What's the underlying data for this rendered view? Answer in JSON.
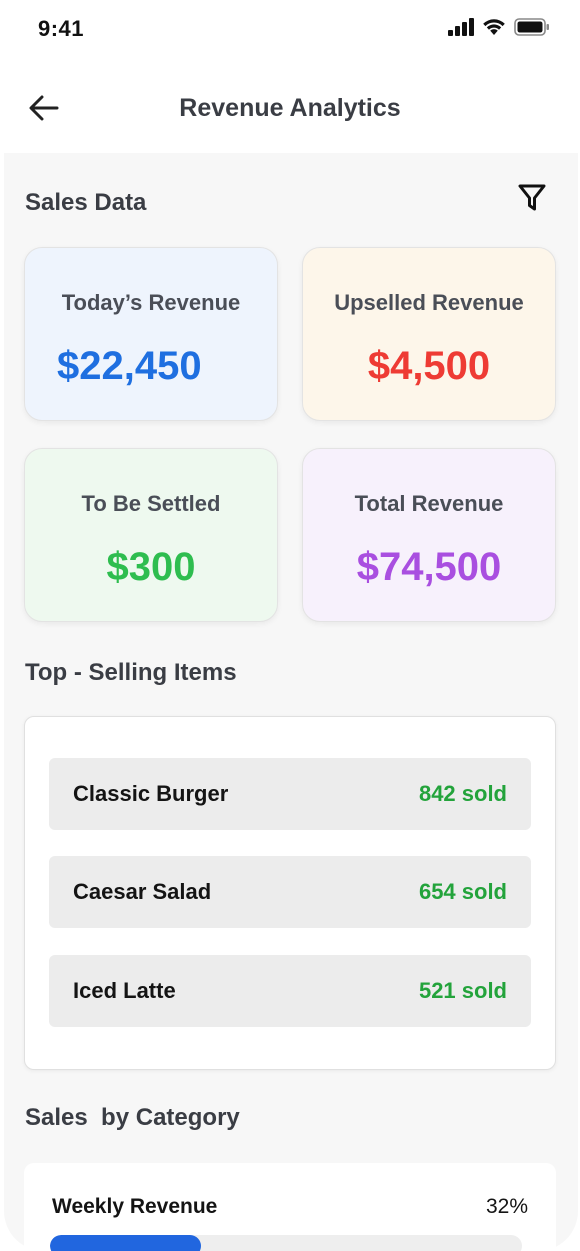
{
  "status_bar": {
    "time": "9:41"
  },
  "header": {
    "title": "Revenue Analytics"
  },
  "sales_data": {
    "title": "Sales Data",
    "cards": [
      {
        "label": "Today’s Revenue",
        "value": "$22,450",
        "bg": "#eef4fd",
        "color": "#1f6fe0"
      },
      {
        "label": "Upselled Revenue",
        "value": "$4,500",
        "bg": "#fdf6ea",
        "color": "#ee3b34"
      },
      {
        "label": "To Be Settled",
        "value": "$300",
        "bg": "#eef9ef",
        "color": "#2ebd4f"
      },
      {
        "label": "Total Revenue",
        "value": "$74,500",
        "bg": "#f7f1fc",
        "color": "#a94fe0"
      }
    ]
  },
  "top_selling": {
    "title": "Top - Selling Items",
    "items": [
      {
        "name": "Classic Burger",
        "sold": "842 sold"
      },
      {
        "name": "Caesar Salad",
        "sold": "654 sold"
      },
      {
        "name": "Iced Latte",
        "sold": "521 sold"
      }
    ]
  },
  "sales_by_category": {
    "title": "Sales  by Category",
    "rows": [
      {
        "label": "Weekly Revenue",
        "percent_text": "32%",
        "percent": 32
      }
    ]
  },
  "colors": {
    "accent_blue": "#2166df",
    "sold_green": "#23a33b"
  }
}
